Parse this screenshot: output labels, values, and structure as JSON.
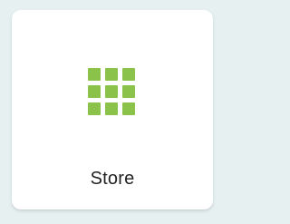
{
  "tile": {
    "label": "Store",
    "icon": "grid-apps-icon",
    "icon_color": "#8bc34a"
  },
  "colors": {
    "background": "#e6f0f1",
    "card": "#ffffff",
    "text": "#222222"
  }
}
